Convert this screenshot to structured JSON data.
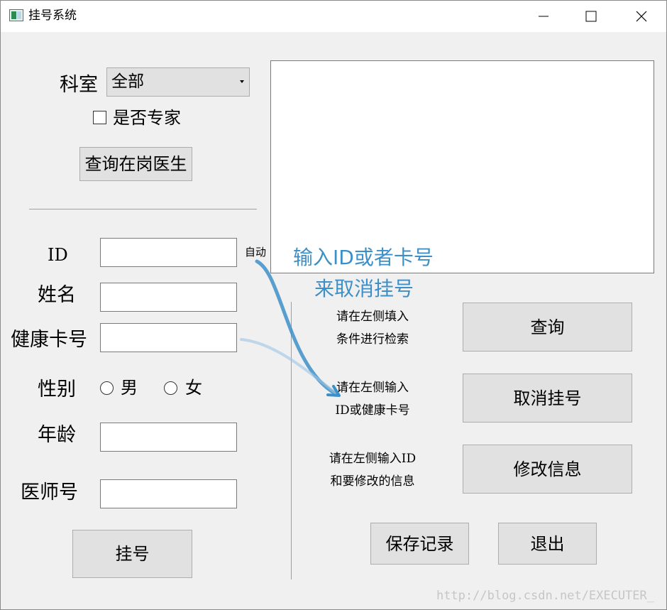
{
  "window": {
    "title": "挂号系统",
    "app_icon": "app-window-icon",
    "controls": [
      "minimize-icon",
      "maximize-icon",
      "close-icon"
    ]
  },
  "left_panel": {
    "department_label": "科室",
    "department_selected": "全部",
    "expert_label": "是否专家",
    "expert_checked": false,
    "query_doctors_button": "查询在岗医生",
    "id_label": "ID",
    "id_auto_note": "自动",
    "name_label": "姓名",
    "health_card_label": "健康卡号",
    "gender_label": "性别",
    "gender_options": [
      "男",
      "女"
    ],
    "age_label": "年龄",
    "doctor_no_label": "医师号",
    "register_button": "挂号"
  },
  "right_panel": {
    "annotation_line1": "输入ID或者卡号",
    "annotation_line2": "来取消挂号",
    "hint_query": [
      "请在左侧填入",
      "条件进行检索"
    ],
    "query_button": "查询",
    "hint_cancel": [
      "请在左侧输入",
      "ID或健康卡号"
    ],
    "cancel_button": "取消挂号",
    "hint_modify": [
      "请在左侧输入ID",
      "和要修改的信息"
    ],
    "modify_button": "修改信息",
    "save_button": "保存记录",
    "exit_button": "退出"
  },
  "watermark": "http://blog.csdn.net/EXECUTER_",
  "colors": {
    "annotation": "#3d8fc8",
    "window_bg": "#f0f0f0",
    "button_bg": "#e1e1e1"
  }
}
